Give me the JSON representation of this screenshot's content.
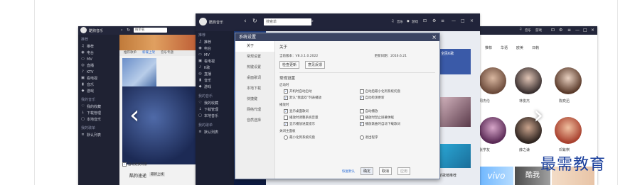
{
  "app": {
    "name": "酷狗音乐",
    "search_placeholder": "搜索单",
    "search_placeholder_back": "搜单名",
    "top_links": [
      "音乐",
      "游戏"
    ],
    "top_links_win3": [
      "音乐",
      "游戏"
    ],
    "window_controls": [
      "⊡",
      "≡",
      "—",
      "□",
      "×"
    ]
  },
  "win1": {
    "sidebar": {
      "head1": "推荐",
      "items": [
        "推荐",
        "电台",
        "MV",
        "直播",
        "KTV",
        "看电视",
        "音乐",
        "游戏"
      ],
      "head2": "我的音乐",
      "items2": [
        "我的收藏",
        "下载管理",
        "本地音乐"
      ],
      "head3": "我的歌单",
      "items3": [
        "默认列表"
      ]
    },
    "tabs": [
      "推荐歌单",
      "新碟上架",
      "音乐专题"
    ],
    "checkbox_label": "自动更换背景",
    "bottom_text": "酷狗速递",
    "bottom_chip": "最新上线"
  },
  "win2": {
    "sidebar": {
      "head1": "推荐",
      "items": [
        "推荐",
        "电台",
        "MV",
        "看电视",
        "K歌",
        "直播",
        "音乐",
        "游戏"
      ],
      "head2": "我的音乐",
      "items2": [
        "我的收藏",
        "下载管理",
        "本地音乐"
      ],
      "head3": "我的歌单",
      "items3": [
        "默认列表"
      ]
    },
    "right_panel": [
      "全民K歌",
      "新歌首发"
    ],
    "bottom_text": "新歌榜推荐"
  },
  "win3": {
    "tabs": [
      "推荐",
      "华语",
      "欧美",
      "日韩"
    ],
    "artists": [
      "周杰伦",
      "林俊杰",
      "陈奕迅",
      "张学友",
      "薛之谦",
      "邓紫棋"
    ],
    "bottom_labels": [
      "vivo",
      "酷我"
    ]
  },
  "dialog": {
    "title": "系统设置",
    "close": "×",
    "nav": [
      "关于",
      "常规设置",
      "热键设置",
      "桌面歌词",
      "本地下载",
      "快捷键",
      "网络代理",
      "音质选择"
    ],
    "about_title": "关于",
    "version_label": "当前版本：V8.3.1.0.2022",
    "date_label": "更新日期：2016.6.21",
    "btn_check": "检查更新",
    "btn_feedback": "意见反馈",
    "common_title": "常规设置",
    "group1": "启动时",
    "g1_items": [
      {
        "label": "开机时自动启动",
        "checked": true
      },
      {
        "label": "启动后最小化到系统托盘",
        "checked": false
      },
      {
        "label": "默认“我喜欢”列表播放",
        "checked": true
      },
      {
        "label": "自动检测更新",
        "checked": true
      }
    ],
    "group2": "播放时",
    "g2_items": [
      {
        "label": "显示桌面歌词",
        "checked": true
      },
      {
        "label": "自动播放",
        "checked": false
      },
      {
        "label": "播放时调整系统音量",
        "checked": false
      },
      {
        "label": "播放时禁止屏幕休眠",
        "checked": false
      },
      {
        "label": "显示播放进度提示",
        "checked": true
      },
      {
        "label": "播放歌曲时自动下载歌词",
        "checked": true
      }
    ],
    "group3": "关闭主面板",
    "g3_items": [
      {
        "label": "最小化到系统托盘",
        "checked": false
      },
      {
        "label": "退出程序",
        "checked": false
      }
    ],
    "link_defaults": "恢复默认",
    "btn_ok": "确定",
    "btn_cancel": "取消",
    "btn_apply": "应用"
  },
  "watermark": "最需教育"
}
